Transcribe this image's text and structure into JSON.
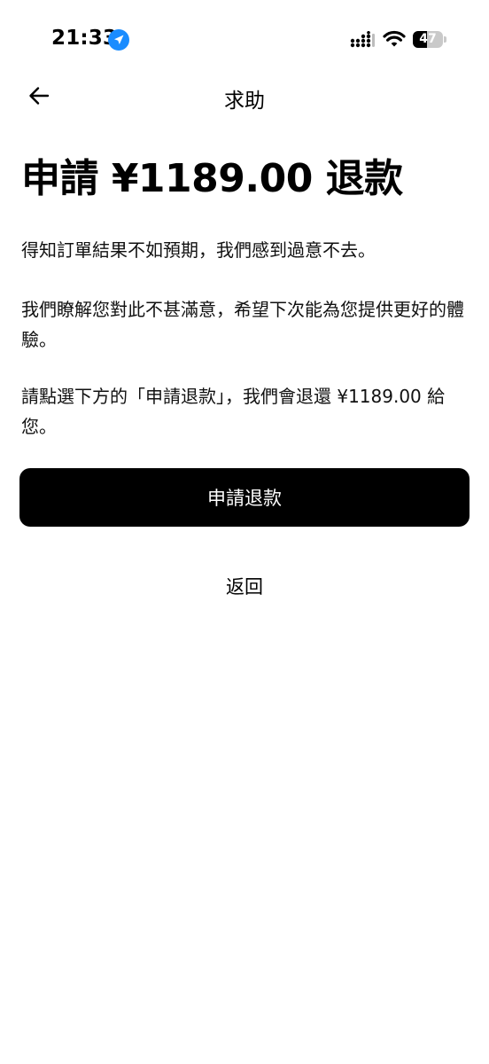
{
  "status_bar": {
    "time": "21:33",
    "battery_level": "47"
  },
  "header": {
    "title": "求助"
  },
  "content": {
    "heading": "申請 ¥1189.00 退款",
    "paragraph1": "得知訂單結果不如預期，我們感到過意不去。",
    "paragraph2": "我們瞭解您對此不甚滿意，希望下次能為您提供更好的體驗。",
    "paragraph3": "請點選下方的「申請退款」，我們會退還 ¥1189.00 給您。"
  },
  "actions": {
    "primary_label": "申請退款",
    "secondary_label": "返回"
  },
  "colors": {
    "location_badge": "#1a8cff",
    "primary_button_bg": "#000000",
    "primary_button_text": "#ffffff"
  },
  "icons": {
    "back": "arrow-left-icon",
    "location": "location-arrow-icon",
    "signal": "cellular-signal-icon",
    "wifi": "wifi-icon",
    "battery": "battery-icon"
  }
}
